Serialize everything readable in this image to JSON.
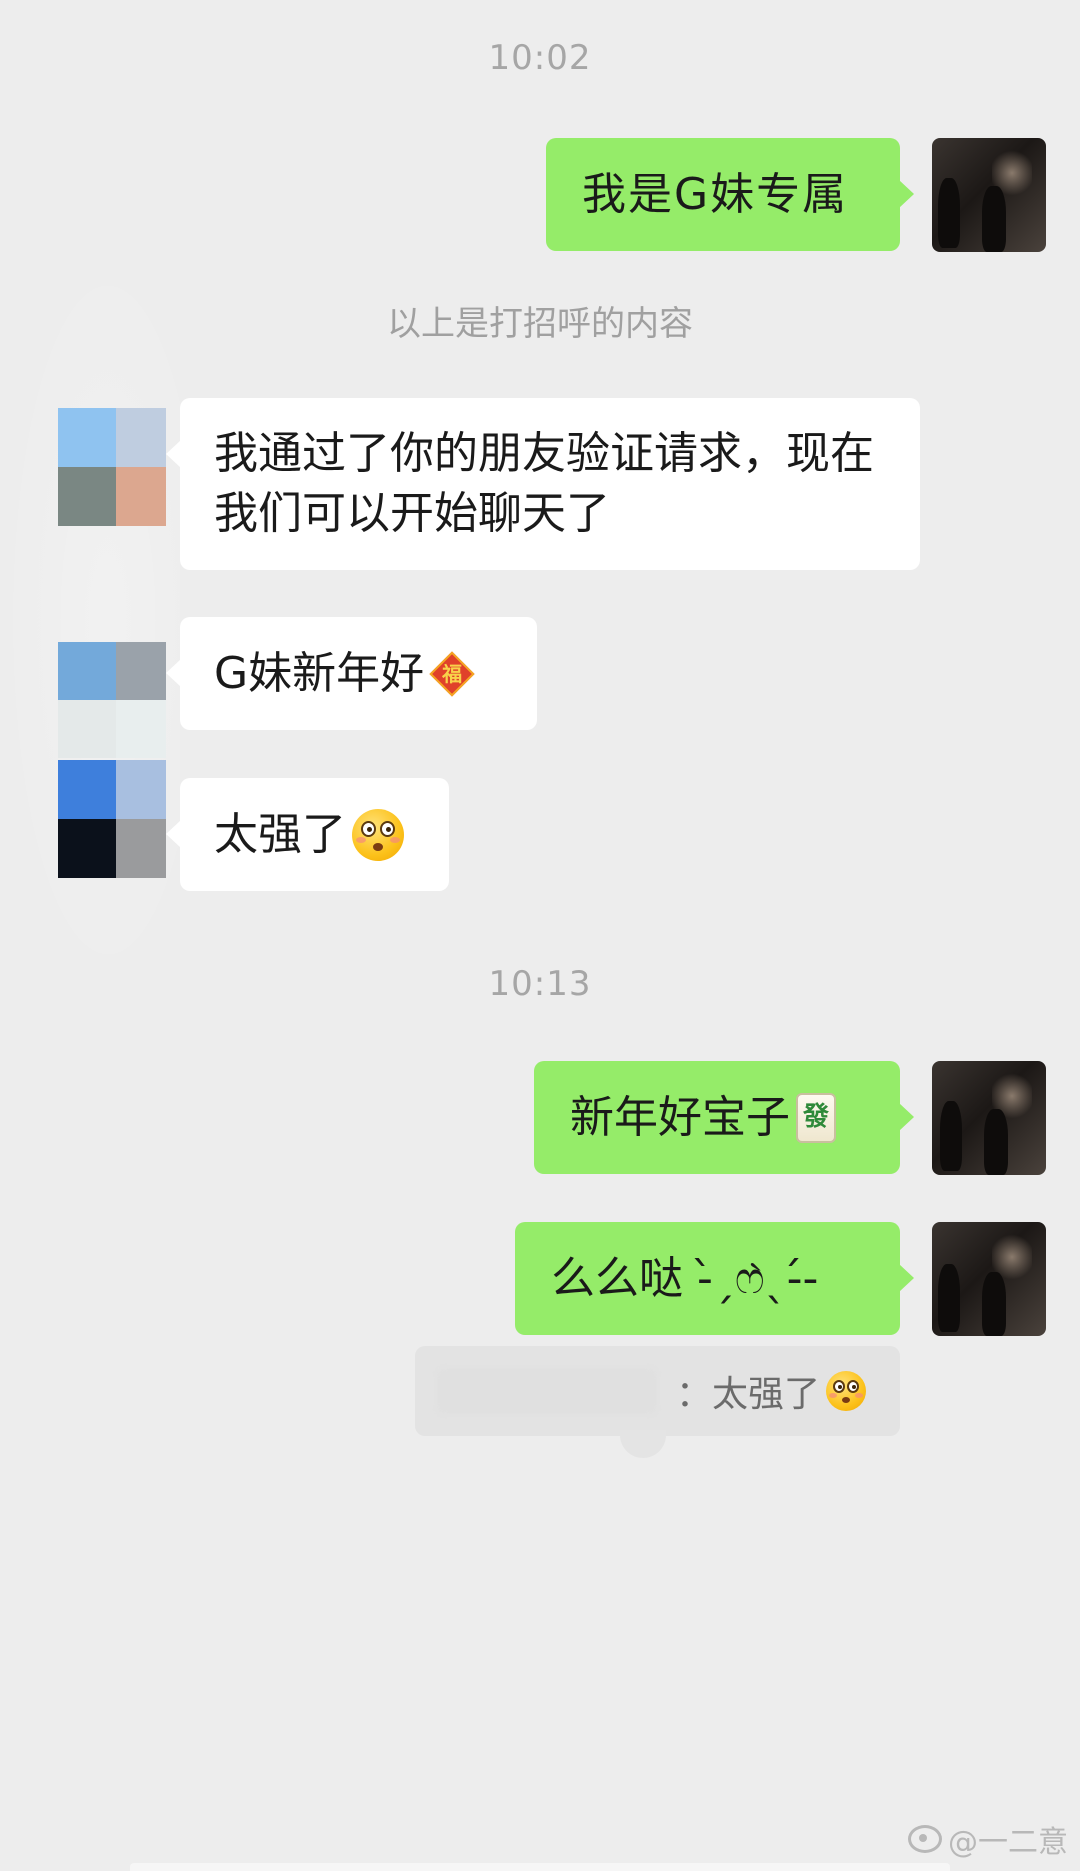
{
  "chat": {
    "timestamp_1": "10:02",
    "greeting_notice": "以上是打招呼的内容",
    "timestamp_2": "10:13",
    "messages": [
      {
        "from": "me",
        "text": "我是G妹专属"
      },
      {
        "from": "them",
        "text": "我通过了你的朋友验证请求，现在我们可以开始聊天了"
      },
      {
        "from": "them",
        "text": "G妹新年好",
        "emoji": "fu-icon"
      },
      {
        "from": "them",
        "text": "太强了",
        "emoji": "flushed-face-icon"
      },
      {
        "from": "me",
        "text": "新年好宝子",
        "emoji": "mahjong-fa-icon"
      },
      {
        "from": "me",
        "text": "么么哒 -̀ˏෆ̀ˎ-́-"
      }
    ],
    "quote": {
      "text": "：太强了",
      "emoji": "flushed-face-icon"
    }
  },
  "watermark": {
    "text": "@一二意"
  },
  "colors": {
    "background": "#ededed",
    "my_bubble": "#95ec69",
    "their_bubble": "#ffffff",
    "timestamp": "#a6a6a6"
  }
}
